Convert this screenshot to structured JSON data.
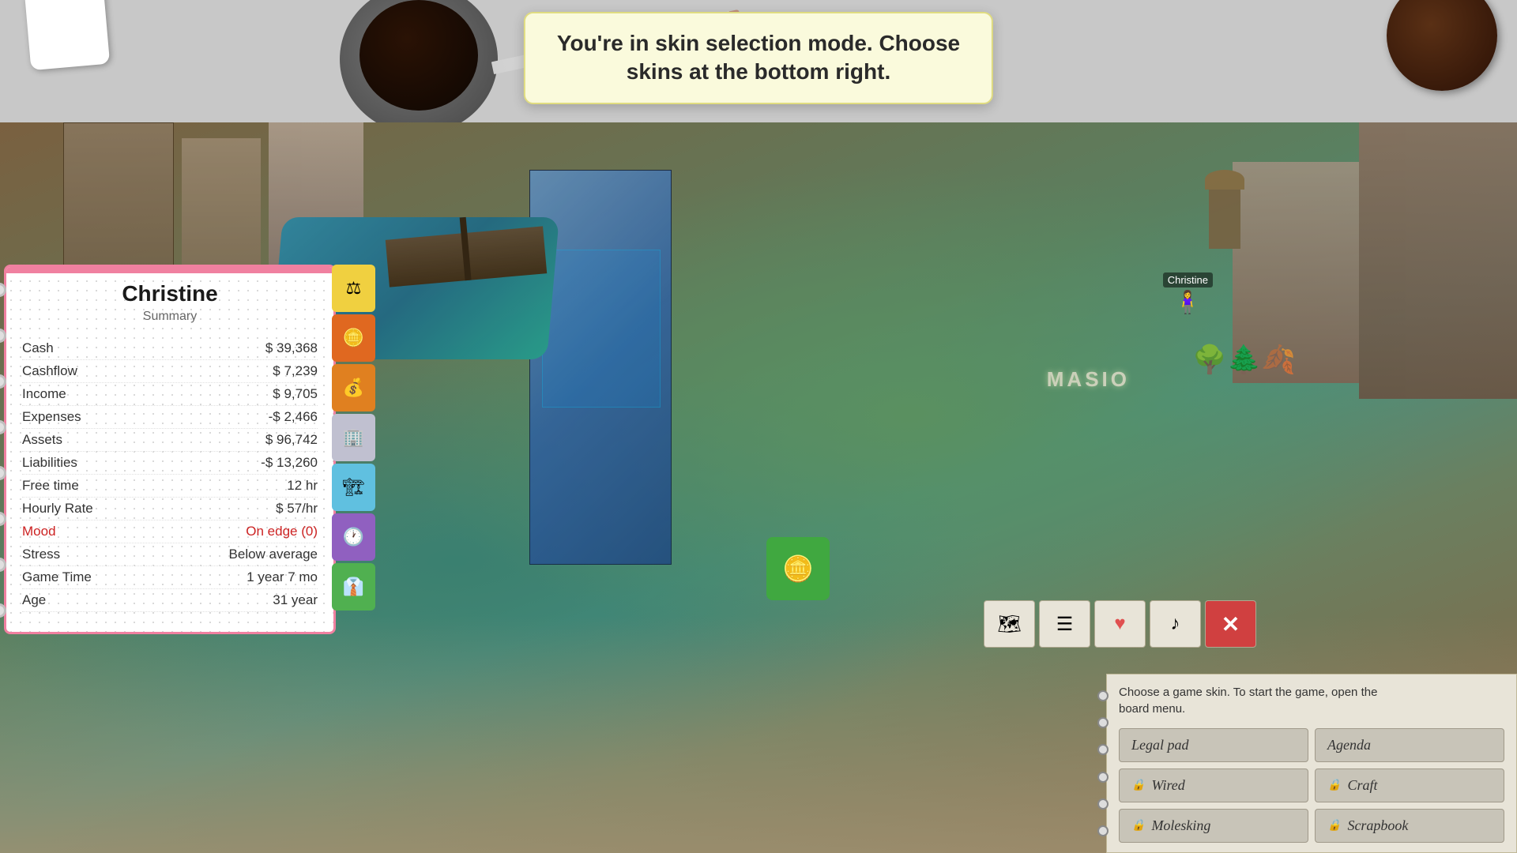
{
  "tooltip": {
    "text": "You're in skin selection mode. Choose\nskins at the bottom right."
  },
  "character": {
    "name": "Christine",
    "subtitle": "Summary",
    "stats": [
      {
        "label": "Cash",
        "value": "$ 39,368",
        "red": false
      },
      {
        "label": "Cashflow",
        "value": "$ 7,239",
        "red": false
      },
      {
        "label": "Income",
        "value": "$ 9,705",
        "red": false
      },
      {
        "label": "Expenses",
        "value": "-$ 2,466",
        "red": false
      },
      {
        "label": "Assets",
        "value": "$ 96,742",
        "red": false
      },
      {
        "label": "Liabilities",
        "value": "-$ 13,260",
        "red": false
      },
      {
        "label": "Free time",
        "value": "12 hr",
        "red": false
      },
      {
        "label": "Hourly Rate",
        "value": "$ 57/hr",
        "red": false
      },
      {
        "label": "Mood",
        "value": "On edge (0)",
        "red": true
      },
      {
        "label": "Stress",
        "value": "Below average",
        "red": false
      },
      {
        "label": "Game Time",
        "value": "1 year 7 mo",
        "red": false
      },
      {
        "label": "Age",
        "value": "31 year",
        "red": false
      }
    ]
  },
  "tabs": [
    {
      "icon": "⚖",
      "color": "yellow"
    },
    {
      "icon": "🪙",
      "color": "orange"
    },
    {
      "icon": "💰",
      "color": "orange2"
    },
    {
      "icon": "🏢",
      "color": "gray"
    },
    {
      "icon": "🏗",
      "color": "blue"
    },
    {
      "icon": "🕐",
      "color": "purple"
    },
    {
      "icon": "👔",
      "color": "green"
    }
  ],
  "skin_panel": {
    "description": "Choose a game skin. To start the game, open the\nboard menu.",
    "skins": [
      {
        "id": "legal-pad",
        "label": "Legal pad",
        "locked": false
      },
      {
        "id": "agenda",
        "label": "Agenda",
        "locked": false
      },
      {
        "id": "wired",
        "label": "Wired",
        "locked": true
      },
      {
        "id": "craft",
        "label": "Craft",
        "locked": true
      },
      {
        "id": "molesking",
        "label": "Molesking",
        "locked": true
      },
      {
        "id": "scrapbook",
        "label": "Scrapbook",
        "locked": true
      }
    ]
  },
  "action_icons": {
    "map": "🗺",
    "list": "☰",
    "heart": "♥",
    "music": "♪",
    "close": "✕"
  },
  "map": {
    "christine_label": "Christine"
  },
  "masio": "MASIO"
}
